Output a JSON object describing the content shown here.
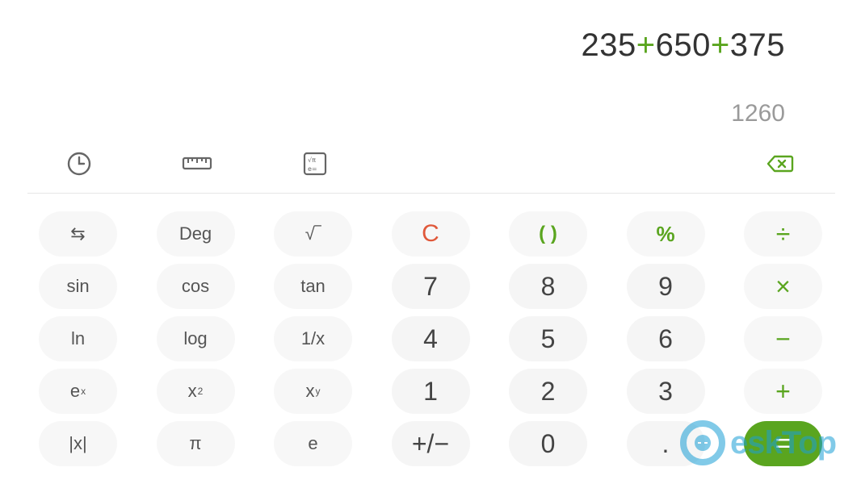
{
  "display": {
    "expression_parts": [
      {
        "text": "235",
        "is_operator": false
      },
      {
        "text": "+",
        "is_operator": true
      },
      {
        "text": "650",
        "is_operator": false
      },
      {
        "text": "+",
        "is_operator": true
      },
      {
        "text": "375",
        "is_operator": false
      }
    ],
    "result": "1260"
  },
  "toolbar": {
    "history_icon": "clock-icon",
    "unit_converter_icon": "ruler-icon",
    "scientific_toggle_icon": "scientific-calculator-icon",
    "backspace_icon": "backspace-icon"
  },
  "keypad": {
    "rows": [
      [
        {
          "label": "⇆",
          "name": "switch-button",
          "kind": "fn"
        },
        {
          "label": "Deg",
          "name": "deg-button",
          "kind": "fn"
        },
        {
          "label": "√‾",
          "name": "sqrt-button",
          "kind": "fn"
        },
        {
          "label": "C",
          "name": "clear-button",
          "kind": "clear"
        },
        {
          "label": "( )",
          "name": "parentheses-button",
          "kind": "paren"
        },
        {
          "label": "%",
          "name": "percent-button",
          "kind": "pct"
        },
        {
          "label": "÷",
          "name": "divide-button",
          "kind": "op"
        }
      ],
      [
        {
          "label": "sin",
          "name": "sin-button",
          "kind": "fn"
        },
        {
          "label": "cos",
          "name": "cos-button",
          "kind": "fn"
        },
        {
          "label": "tan",
          "name": "tan-button",
          "kind": "fn"
        },
        {
          "label": "7",
          "name": "digit-7-button",
          "kind": "num"
        },
        {
          "label": "8",
          "name": "digit-8-button",
          "kind": "num"
        },
        {
          "label": "9",
          "name": "digit-9-button",
          "kind": "num"
        },
        {
          "label": "×",
          "name": "multiply-button",
          "kind": "op"
        }
      ],
      [
        {
          "label": "ln",
          "name": "ln-button",
          "kind": "fn"
        },
        {
          "label": "log",
          "name": "log-button",
          "kind": "fn"
        },
        {
          "label": "1/x",
          "name": "reciprocal-button",
          "kind": "fn"
        },
        {
          "label": "4",
          "name": "digit-4-button",
          "kind": "num"
        },
        {
          "label": "5",
          "name": "digit-5-button",
          "kind": "num"
        },
        {
          "label": "6",
          "name": "digit-6-button",
          "kind": "num"
        },
        {
          "label": "−",
          "name": "subtract-button",
          "kind": "op"
        }
      ],
      [
        {
          "label": "e",
          "sup": "x",
          "name": "exp-button",
          "kind": "fn"
        },
        {
          "label": "x",
          "sup": "2",
          "name": "square-button",
          "kind": "fn"
        },
        {
          "label": "x",
          "sup": "y",
          "name": "power-button",
          "kind": "fn"
        },
        {
          "label": "1",
          "name": "digit-1-button",
          "kind": "num"
        },
        {
          "label": "2",
          "name": "digit-2-button",
          "kind": "num"
        },
        {
          "label": "3",
          "name": "digit-3-button",
          "kind": "num"
        },
        {
          "label": "+",
          "name": "add-button",
          "kind": "op"
        }
      ],
      [
        {
          "label": "|x|",
          "name": "abs-button",
          "kind": "fn"
        },
        {
          "label": "π",
          "name": "pi-button",
          "kind": "fn"
        },
        {
          "label": "e",
          "name": "euler-button",
          "kind": "fn"
        },
        {
          "label": "+/−",
          "name": "negate-button",
          "kind": "num"
        },
        {
          "label": "0",
          "name": "digit-0-button",
          "kind": "num"
        },
        {
          "label": ".",
          "name": "decimal-button",
          "kind": "num"
        },
        {
          "label": "=",
          "name": "equals-button",
          "kind": "equals"
        }
      ]
    ]
  },
  "watermark": {
    "text": "eskTop"
  },
  "colors": {
    "accent": "#5aa51f",
    "clear": "#e0583a",
    "text": "#333333",
    "result": "#9a9a9a"
  }
}
